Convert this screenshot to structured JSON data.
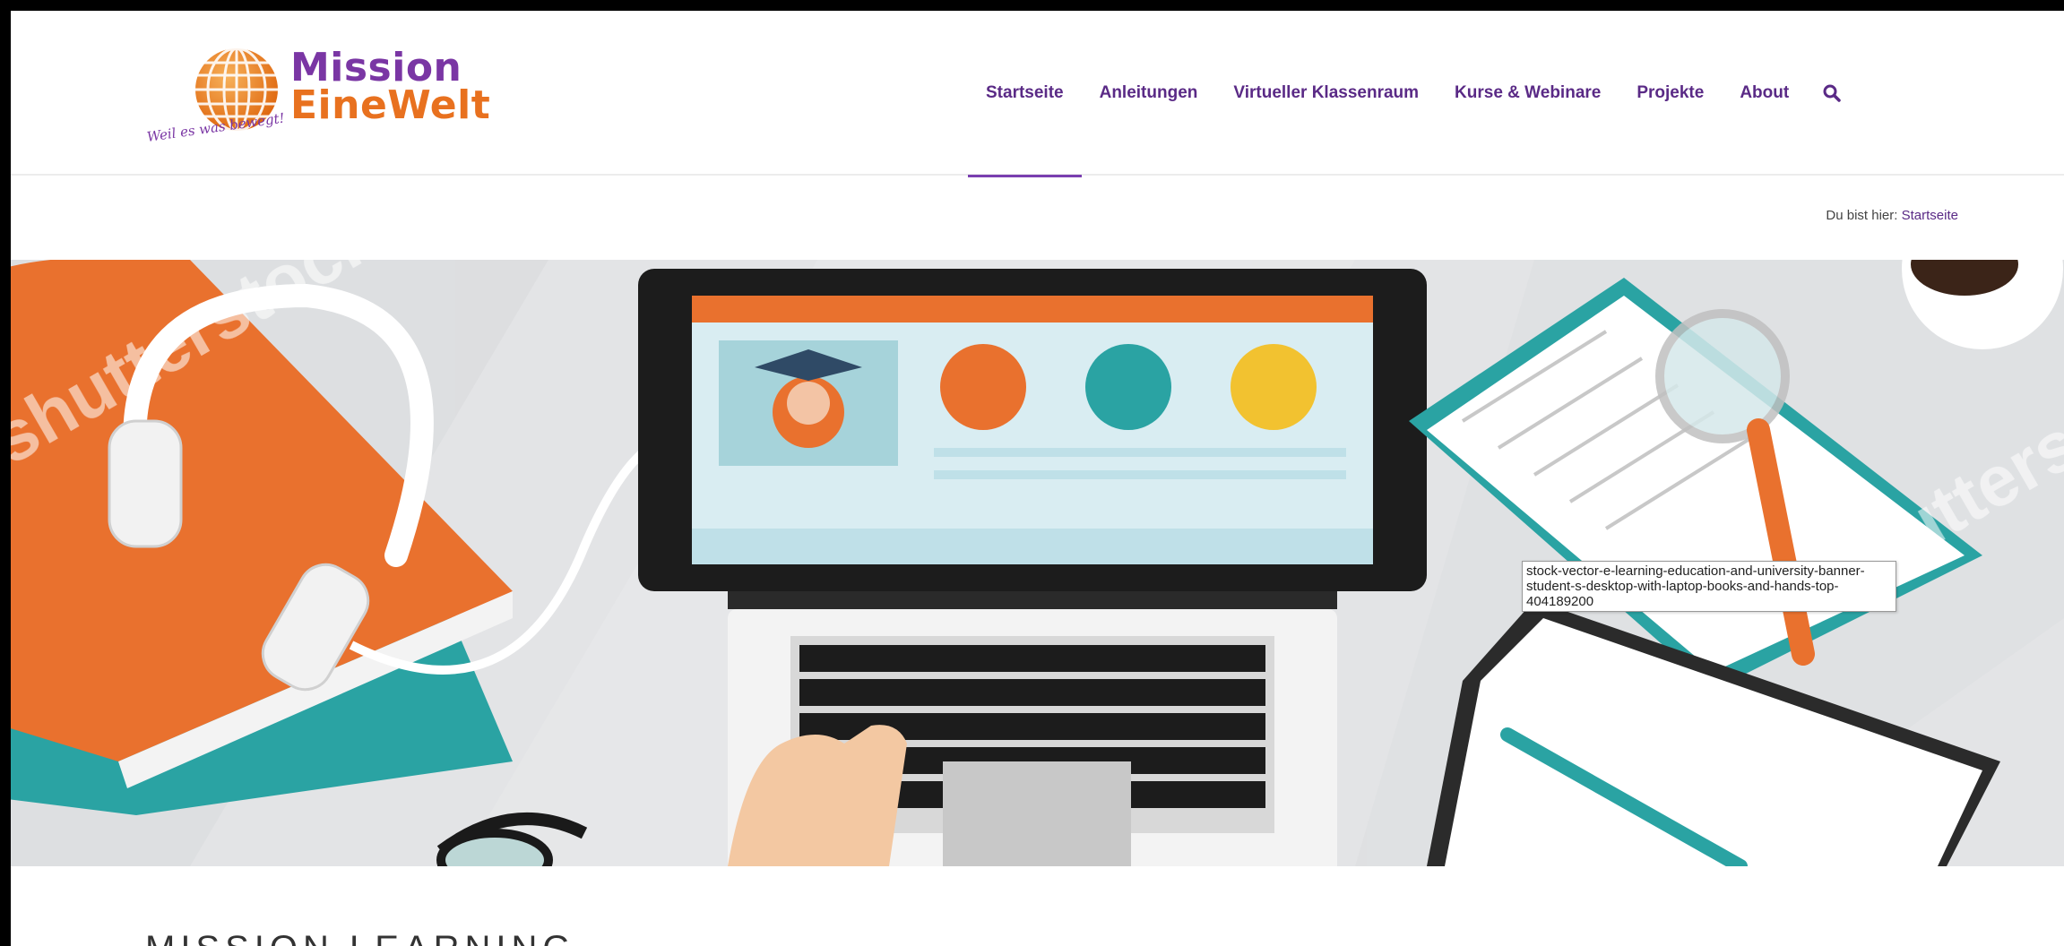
{
  "logo": {
    "title_line1": "Mission",
    "title_line2": "EineWelt",
    "tagline": "Weil es was bewegt!",
    "colors": {
      "purple": "#7a36a4",
      "orange": "#e8711f"
    }
  },
  "nav": {
    "items": [
      {
        "label": "Startseite",
        "active": true
      },
      {
        "label": "Anleitungen",
        "active": false
      },
      {
        "label": "Virtueller Klassenraum",
        "active": false
      },
      {
        "label": "Kurse & Webinare",
        "active": false
      },
      {
        "label": "Projekte",
        "active": false
      },
      {
        "label": "About",
        "active": false
      }
    ],
    "search_icon": "search-icon",
    "accent": "#5a2a86"
  },
  "breadcrumb": {
    "prefix": "Du bist hier:",
    "current": "Startseite"
  },
  "hero": {
    "image_tooltip": "stock-vector-e-learning-education-and-university-banner-student-s-desktop-with-laptop-books-and-hands-top-404189200",
    "watermark": "shutterstock"
  },
  "page": {
    "heading": "MISSION LEARNING"
  }
}
